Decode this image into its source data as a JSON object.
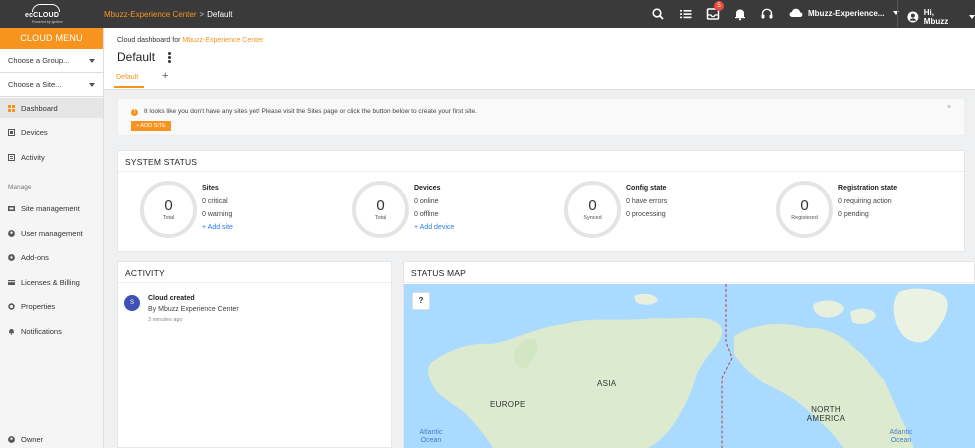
{
  "topbar": {
    "logo_text": "ecCLOUD",
    "logo_sub": "Powered by Ignition",
    "crumb_link": "Mbuzz-Experience Center",
    "crumb_sep": ">",
    "crumb_current": "Default",
    "notification_count": "5",
    "cloud_name": "Mbuzz-Experience...",
    "user_greeting": "Hi, Mbuzz"
  },
  "sidebar": {
    "menu_title": "CLOUD MENU",
    "group_select": "Choose a Group...",
    "site_select": "Choose a Site...",
    "items": [
      {
        "label": "Dashboard"
      },
      {
        "label": "Devices"
      },
      {
        "label": "Activity"
      }
    ],
    "manage_heading": "Manage",
    "manage_items": [
      {
        "label": "Site management"
      },
      {
        "label": "User management"
      },
      {
        "label": "Add-ons"
      },
      {
        "label": "Licenses & Billing"
      },
      {
        "label": "Properties"
      },
      {
        "label": "Notifications"
      }
    ],
    "footer_item": "Owner"
  },
  "header": {
    "dashboard_for": "Cloud dashboard for",
    "cloud_link": "Mbuzz-Experience Center",
    "title": "Default",
    "tab": "Default",
    "add_tab": "+"
  },
  "alert": {
    "message": "It looks like you don't have any sites yet! Please visit the Sites page or click the button below to create your first site.",
    "button": "+ ADD SITE",
    "close": "×"
  },
  "system_status": {
    "title": "SYSTEM STATUS",
    "stats": [
      {
        "value": "0",
        "ring_label": "Total",
        "heading": "Sites",
        "line1": "0 critical",
        "line2": "0 warning",
        "link": "+ Add site"
      },
      {
        "value": "0",
        "ring_label": "Total",
        "heading": "Devices",
        "line1": "0 online",
        "line2": "0 offline",
        "link": "+ Add device"
      },
      {
        "value": "0",
        "ring_label": "Synced",
        "heading": "Config state",
        "line1": "0 have errors",
        "line2": "0 processing",
        "link": ""
      },
      {
        "value": "0",
        "ring_label": "Registered",
        "heading": "Registration state",
        "line1": "0 requiring action",
        "line2": "0 pending",
        "link": ""
      }
    ]
  },
  "activity": {
    "title": "ACTIVITY",
    "items": [
      {
        "avatar": "S",
        "title": "Cloud created",
        "by": "By Mbuzz Experience Center",
        "time": "3 minutes ago"
      }
    ]
  },
  "status_map": {
    "title": "STATUS MAP",
    "help": "?",
    "labels": {
      "asia": "ASIA",
      "europe": "EUROPE",
      "north_america": "NORTH AMERICA",
      "atlantic_left": "Atlantic Ocean",
      "atlantic_right": "Atlantic Ocean"
    },
    "colors": {
      "ocean": "#aadaff",
      "land": "#dcebcf"
    }
  },
  "colors": {
    "accent": "#f7941d",
    "topbar": "#3a3a3a",
    "link": "#2c7be5"
  }
}
